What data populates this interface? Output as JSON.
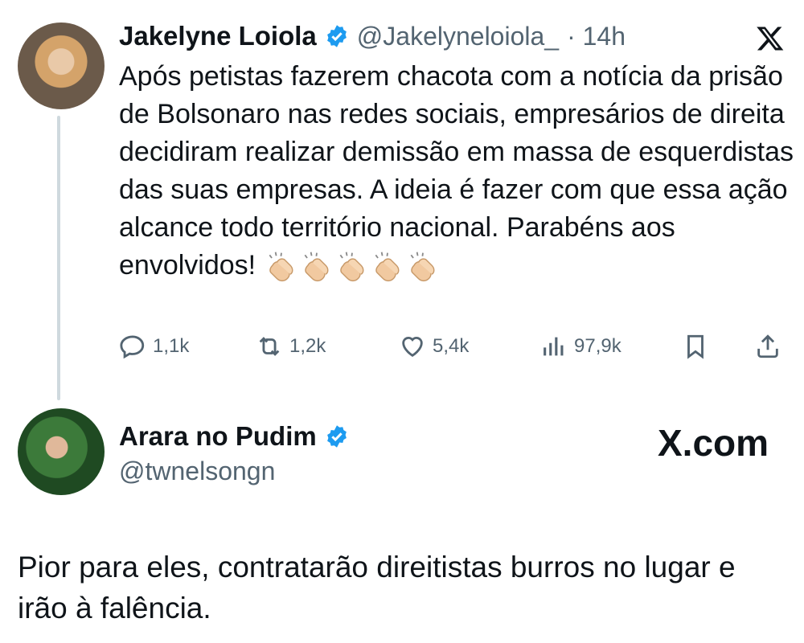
{
  "tweet": {
    "author_name": "Jakelyne Loiola",
    "handle": "@Jakelyneloiola_",
    "time": "· 14h",
    "text": "Após petistas fazerem chacota com a notícia da prisão de Bolsonaro nas redes sociais, empresários de direita decidiram realizar demissão em massa de esquerdistas das suas empresas. A ideia é fazer com que essa ação alcance todo território nacional. Parabéns aos envolvidos!",
    "clap_count": 5,
    "metrics": {
      "replies": "1,1k",
      "retweets": "1,2k",
      "likes": "5,4k",
      "views": "97,9k"
    }
  },
  "reply": {
    "author_name": "Arara no Pudim",
    "handle": "@twnelsongn",
    "site_label": "X.com",
    "text": "Pior para eles, contratarão direitistas burros no lugar e irão à falência."
  },
  "colors": {
    "verified": "#1d9bf0",
    "muted": "#536471",
    "text": "#0f1419"
  }
}
